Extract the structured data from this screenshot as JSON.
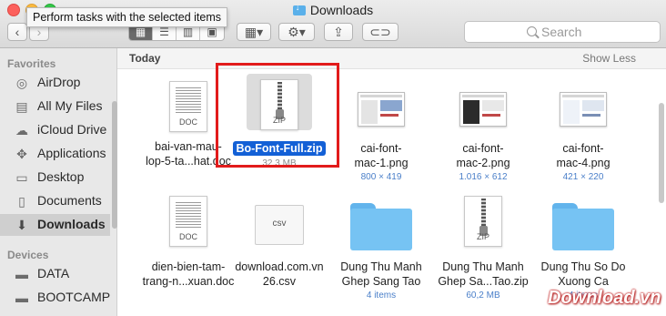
{
  "window": {
    "title": "Downloads"
  },
  "tooltip": "Perform tasks with the selected items",
  "toolbar": {
    "back": "‹",
    "forward": "›",
    "view_modes": [
      "icon-view",
      "list-view",
      "column-view",
      "cover-flow-view"
    ],
    "arrange": "arrange-menu",
    "action": "action-menu",
    "share": "share",
    "tags": "tags"
  },
  "search": {
    "placeholder": "Search"
  },
  "sidebar": {
    "favorites_label": "Favorites",
    "favorites": [
      {
        "label": "AirDrop",
        "icon": "airdrop-icon"
      },
      {
        "label": "All My Files",
        "icon": "all-files-icon"
      },
      {
        "label": "iCloud Drive",
        "icon": "cloud-icon"
      },
      {
        "label": "Applications",
        "icon": "applications-icon"
      },
      {
        "label": "Desktop",
        "icon": "desktop-icon"
      },
      {
        "label": "Documents",
        "icon": "documents-icon"
      },
      {
        "label": "Downloads",
        "icon": "downloads-icon",
        "selected": true
      }
    ],
    "devices_label": "Devices",
    "devices": [
      {
        "label": "DATA",
        "icon": "disk-icon"
      },
      {
        "label": "BOOTCAMP",
        "icon": "disk-icon"
      }
    ]
  },
  "group": {
    "title": "Today",
    "toggle": "Show Less"
  },
  "files": [
    {
      "line1": "bai-van-mau-",
      "line2": "lop-5-ta...hat.doc",
      "sub": "",
      "kind": "DOC"
    },
    {
      "line1": "Bo-Font-Full.zip",
      "line2": "",
      "sub": "32,3 MB",
      "kind": "ZIP",
      "selected": true
    },
    {
      "line1": "cai-font-",
      "line2": "mac-1.png",
      "sub": "800 × 419",
      "kind": "PNG"
    },
    {
      "line1": "cai-font-",
      "line2": "mac-2.png",
      "sub": "1.016 × 612",
      "kind": "PNG"
    },
    {
      "line1": "cai-font-",
      "line2": "mac-4.png",
      "sub": "421 × 220",
      "kind": "PNG"
    },
    {
      "line1": "dien-bien-tam-",
      "line2": "trang-n...xuan.doc",
      "sub": "",
      "kind": "DOC"
    },
    {
      "line1": "download.com.vn",
      "line2": "26.csv",
      "sub": "",
      "kind": "csv"
    },
    {
      "line1": "Dung Thu Manh",
      "line2": "Ghep Sang Tao",
      "sub": "4 items",
      "kind": "folder"
    },
    {
      "line1": "Dung Thu Manh",
      "line2": "Ghep Sa...Tao.zip",
      "sub": "60,2 MB",
      "kind": "ZIP"
    },
    {
      "line1": "Dung Thu So Do",
      "line2": "Xuong Ca",
      "sub": "4 items",
      "kind": "folder"
    }
  ],
  "watermark": "Download.vn",
  "colors": {
    "selection": "#1360d6",
    "highlight_box": "#e21b1b",
    "folder": "#76c3f3",
    "sub_text": "#4a7fc9"
  }
}
